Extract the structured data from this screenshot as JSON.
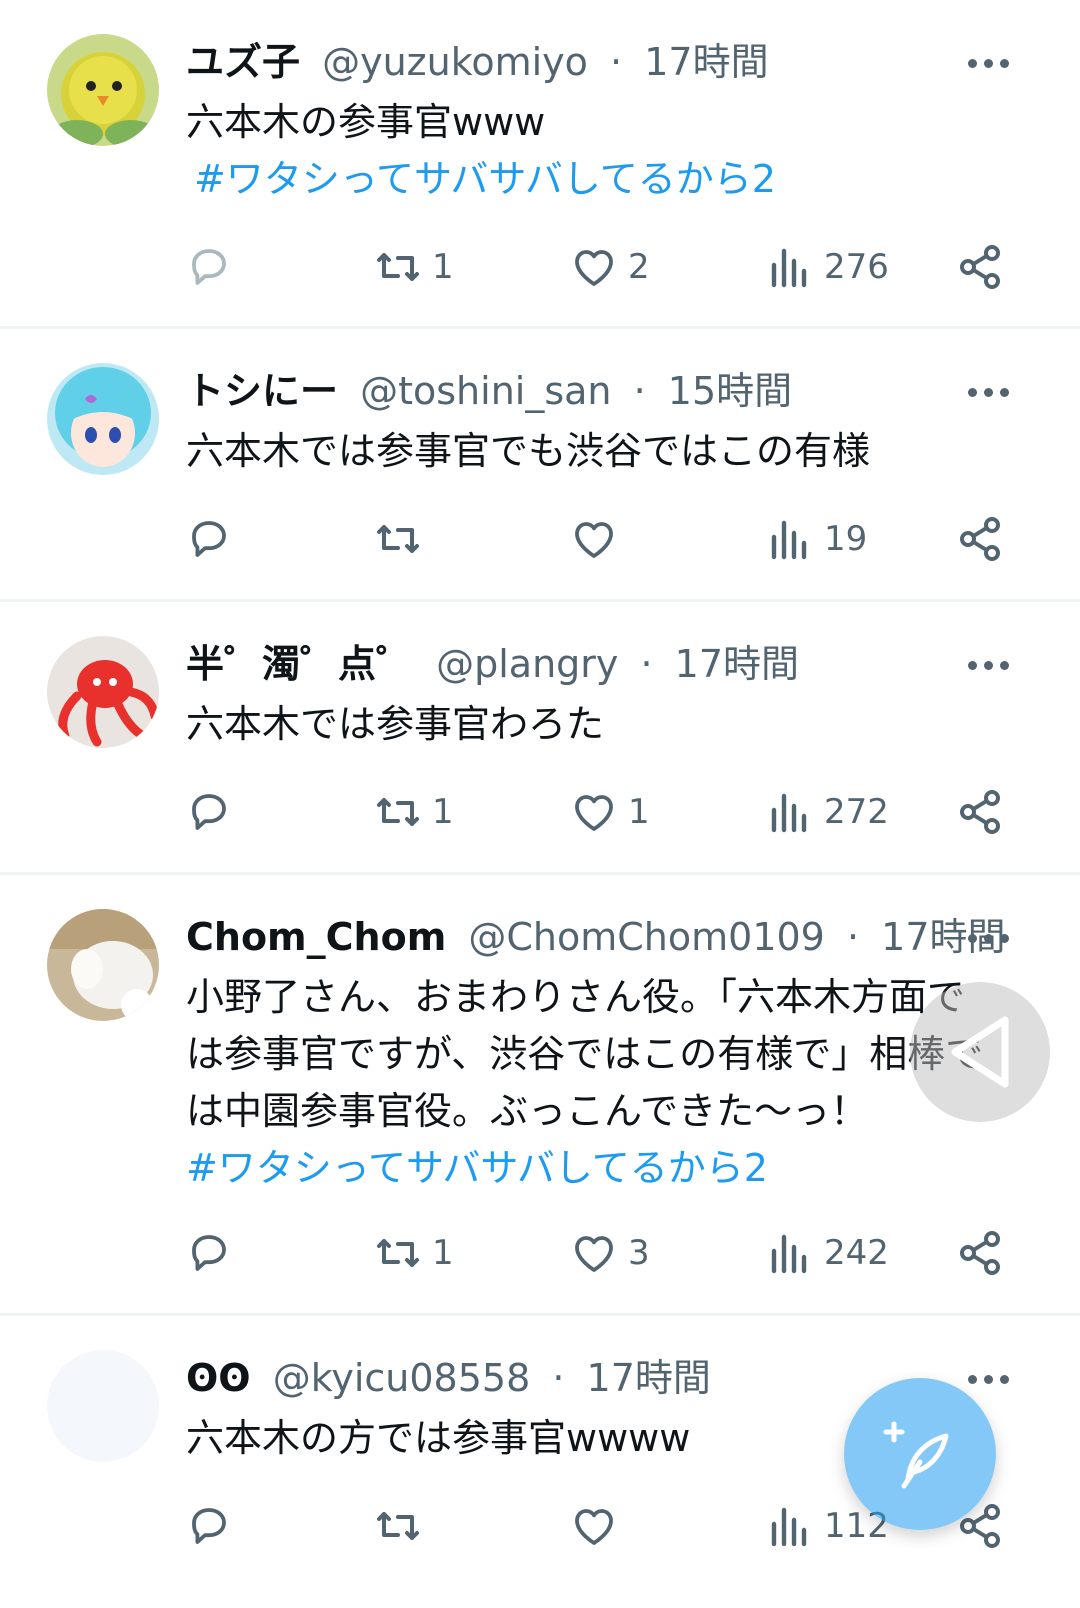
{
  "tweets": [
    {
      "display_name": "ユズ子",
      "handle": "@yuzukomiyo",
      "time": "17時間",
      "lines": [
        "六本木の参事官www"
      ],
      "hashtag": "#ワタシってサバサバしてるから2",
      "avatar_icon": "yellow-chick-avatar",
      "stats": {
        "reply": "",
        "retweet": "1",
        "like": "2",
        "views": "276"
      }
    },
    {
      "display_name": "トシにー",
      "handle": "@toshini_san",
      "time": "15時間",
      "lines": [
        "六本木では参事官でも渋谷ではこの有様"
      ],
      "hashtag": "",
      "avatar_icon": "blue-hair-anime-avatar",
      "stats": {
        "reply": "",
        "retweet": "",
        "like": "",
        "views": "19"
      }
    },
    {
      "display_name": "半゜濁゜点゜",
      "handle": "@plangry",
      "time": "17時間",
      "lines": [
        "六本木では参事官わろた"
      ],
      "hashtag": "",
      "avatar_icon": "red-octopus-avatar",
      "stats": {
        "reply": "",
        "retweet": "1",
        "like": "1",
        "views": "272"
      }
    },
    {
      "display_name": "Chom_Chom",
      "handle": "@ChomChom0109",
      "time": "17時間",
      "lines": [
        "小野了さん、おまわりさん役。「六本木方面で",
        "は参事官ですが、渋谷ではこの有様で」相棒で",
        "は中園参事官役。ぶっこんできた〜っ！"
      ],
      "hashtag": "#ワタシってサバサバしてるから2",
      "avatar_icon": "cat-paw-avatar",
      "stats": {
        "reply": "",
        "retweet": "1",
        "like": "3",
        "views": "242"
      }
    },
    {
      "display_name": "ʘʘ",
      "handle": "@kyicu08558",
      "time": "17時間",
      "lines": [
        "六本木の方では参事官wwww"
      ],
      "hashtag": "",
      "avatar_icon": "blank-avatar",
      "stats": {
        "reply": "",
        "retweet": "",
        "like": "",
        "views": "112"
      }
    }
  ],
  "meta_separator": "·",
  "icons": {
    "more": "more-dots-icon",
    "reply": "reply-icon",
    "retweet": "retweet-icon",
    "like": "heart-icon",
    "views": "views-chart-icon",
    "share": "share-icon",
    "compose": "compose-feather-icon",
    "back": "back-triangle-icon"
  },
  "colors": {
    "link": "#1d9bf0",
    "secondary_text": "#536471",
    "primary_text": "#0f1419",
    "divider": "#eff3f4"
  }
}
